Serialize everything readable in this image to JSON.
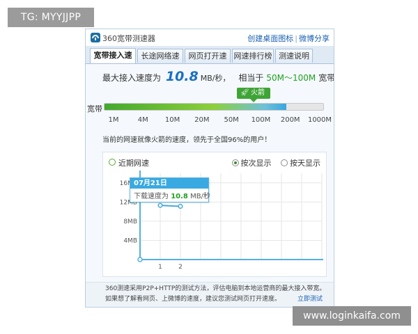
{
  "watermark": {
    "top_left": "TG: MYYJJPP",
    "bottom_right": "www.loginkaifa.com"
  },
  "app": {
    "title": "360宽带测速器",
    "links": [
      "创建桌面图标",
      "微博分享"
    ],
    "link_separator": "|"
  },
  "tabs": [
    {
      "label": "宽带接入速度",
      "active": true
    },
    {
      "label": "长途网络速度",
      "active": false
    },
    {
      "label": "网页打开速度",
      "active": false
    },
    {
      "label": "网速排行榜",
      "active": false
    },
    {
      "label": "测速说明",
      "active": false
    }
  ],
  "result": {
    "prefix": "最大接入速度为",
    "speed_value": "10.8",
    "speed_unit": "MB/秒，",
    "equivalent_prefix": "相当于",
    "equivalent_range": "50M～100M",
    "equivalent_suffix": "宽带"
  },
  "speed_bar": {
    "label": "宽带",
    "badge": "火箭",
    "fill_fraction": 0.83,
    "ticks": [
      "1M",
      "4M",
      "10M",
      "20M",
      "50M",
      "100M",
      "200M",
      "1000M"
    ]
  },
  "comparison": "当前的网速就像火箭的速度，领先于全国96%的用户！",
  "recent": {
    "title": "近期网速",
    "view_options": [
      {
        "label": "按次显示",
        "selected": true
      },
      {
        "label": "按天显示",
        "selected": false
      }
    ]
  },
  "tooltip": {
    "date": "07月21日",
    "label": "下载速度为",
    "value": "10.8",
    "unit": "MB/秒"
  },
  "footer": {
    "line1": "360测速采用P2P+HTTP的测试方法，评估电脑到本地运营商的最大接入带宽。",
    "line2": "如果想了解看网页、上微博的速度，建议您测试网页打开速度。",
    "link": "立即测试"
  },
  "chart_data": {
    "type": "line",
    "title": "近期网速",
    "xlabel": "",
    "ylabel": "",
    "x": [
      1,
      2
    ],
    "series": [
      {
        "values": [
          11.3,
          11.1
        ]
      }
    ],
    "y_ticks": [
      "4MB",
      "8MB",
      "12MB",
      "16MB"
    ],
    "x_ticks": [
      "1",
      "2"
    ],
    "ylim": [
      0,
      18
    ],
    "xlim": [
      0,
      9
    ],
    "grid": true,
    "highlight": {
      "x": 1,
      "y": 10.8,
      "label": "07月21日"
    },
    "colors": {
      "line": "#4aa8dc",
      "axis": "#55aee0",
      "grid": "#e6e6e6"
    }
  }
}
